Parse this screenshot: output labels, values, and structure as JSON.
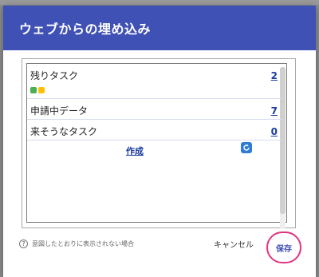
{
  "dialog": {
    "title": "ウェブからの埋め込み"
  },
  "preview": {
    "rows": [
      {
        "label": "残りタスク",
        "count": "2"
      },
      {
        "label": "申請中データ",
        "count": "7"
      },
      {
        "label": "来そうなタスク",
        "count": "0"
      }
    ],
    "status_colors": [
      "#4caf50",
      "#ffc107"
    ],
    "create_label": "作成",
    "refresh_icon": "refresh-icon"
  },
  "footer": {
    "help_text": "意図したとおりに表示されない場合",
    "cancel_label": "キャンセル",
    "save_label": "保存"
  },
  "colors": {
    "header": "#3f51b5",
    "link": "#1a3c9e",
    "highlight_ring": "#e0357f"
  }
}
